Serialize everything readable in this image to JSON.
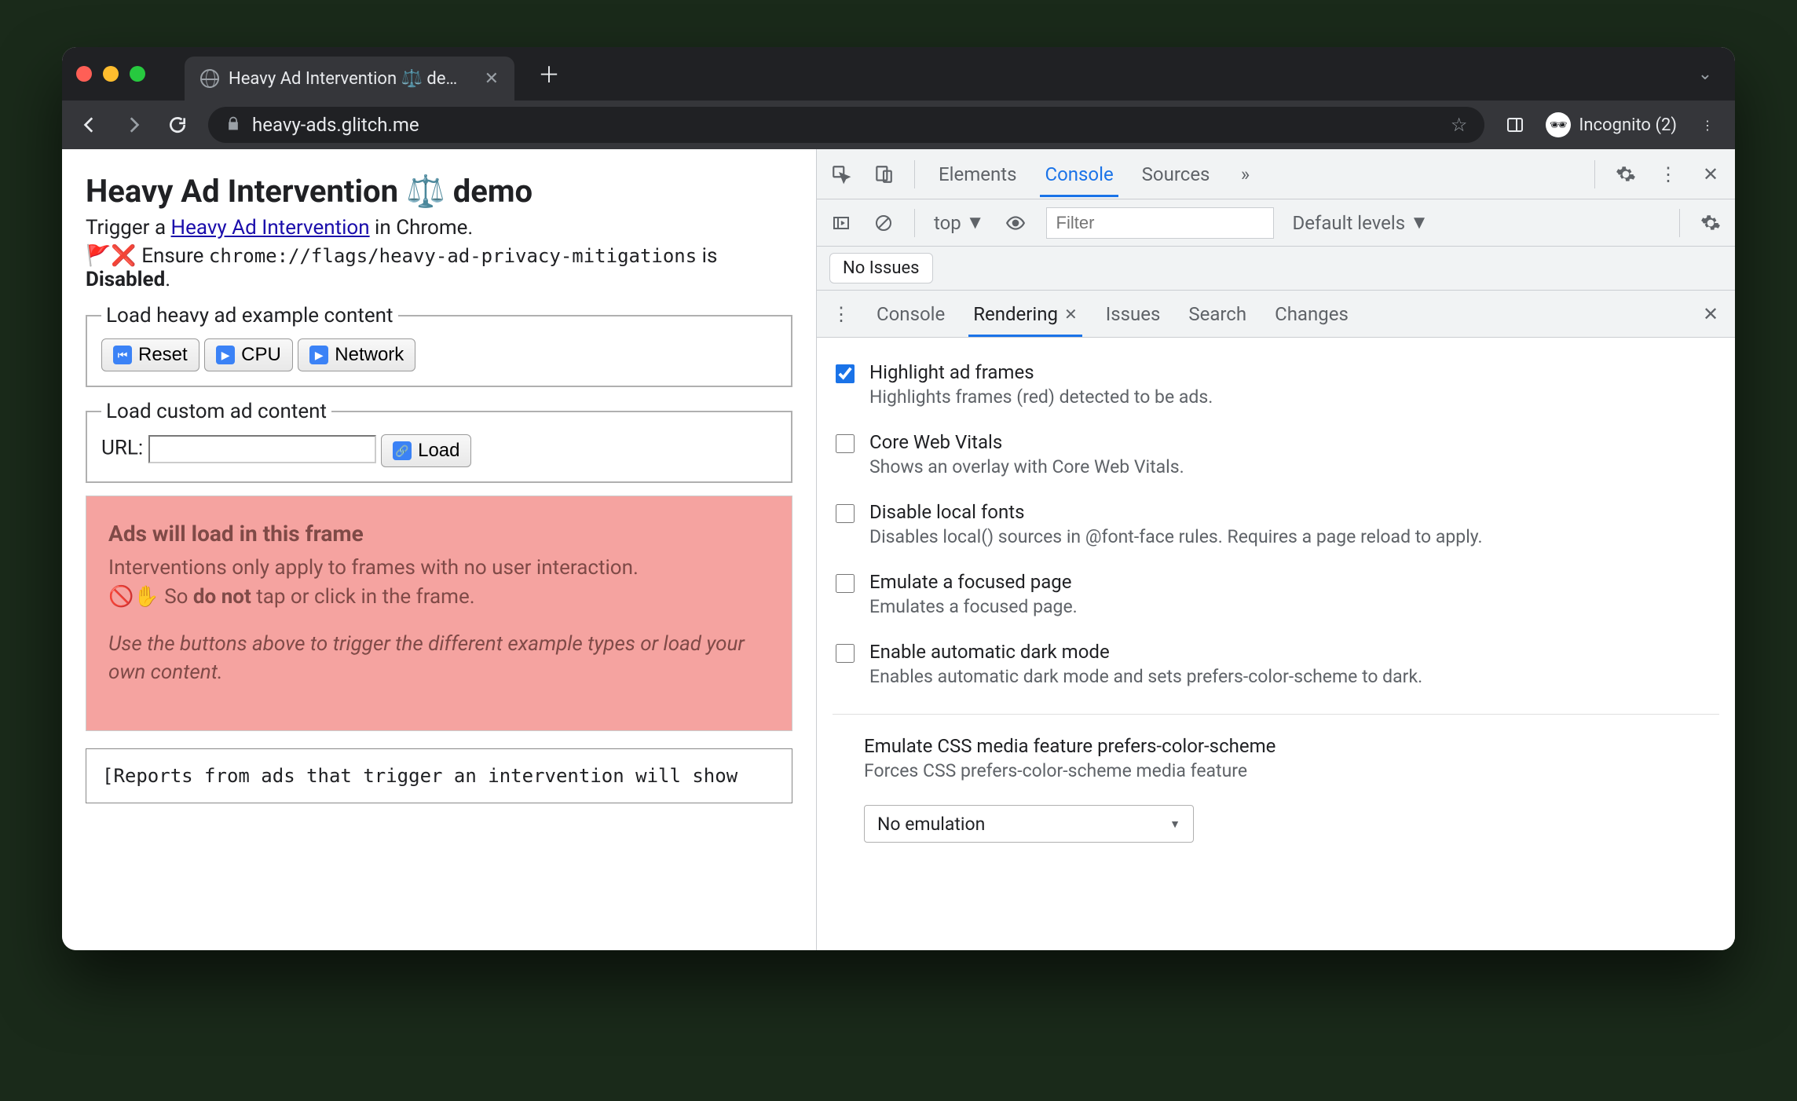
{
  "browser": {
    "tab_title": "Heavy Ad Intervention ⚖️ demo",
    "url": "heavy-ads.glitch.me",
    "incognito_label": "Incognito (2)"
  },
  "page": {
    "heading": "Heavy Ad Intervention ⚖️ demo",
    "subtitle_pre": "Trigger a ",
    "subtitle_link": "Heavy Ad Intervention",
    "subtitle_post": " in Chrome.",
    "warn_pre": "🚩❌ Ensure ",
    "warn_code": "chrome://flags/heavy-ad-privacy-mitigations",
    "warn_post_pre": "is ",
    "warn_post_bold": "Disabled",
    "warn_post_end": ".",
    "fs1_legend": "Load heavy ad example content",
    "btn_reset": "Reset",
    "btn_cpu": "CPU",
    "btn_network": "Network",
    "fs2_legend": "Load custom ad content",
    "url_label": "URL:",
    "btn_load": "Load",
    "ad_header": "Ads will load in this frame",
    "ad_line1": "Interventions only apply to frames with no user interaction.",
    "ad_line2_pre": "🚫✋ So ",
    "ad_line2_bold": "do not",
    "ad_line2_post": " tap or click in the frame.",
    "ad_hint": "Use the buttons above to trigger the different example types or load your own content.",
    "reports": "[Reports from ads that trigger an intervention will show"
  },
  "devtools": {
    "main_tabs": {
      "elements": "Elements",
      "console": "Console",
      "sources": "Sources"
    },
    "console_bar": {
      "context": "top",
      "filter_placeholder": "Filter",
      "levels": "Default levels"
    },
    "no_issues": "No Issues",
    "drawer_tabs": {
      "console": "Console",
      "rendering": "Rendering",
      "issues": "Issues",
      "search": "Search",
      "changes": "Changes"
    },
    "rendering_opts": [
      {
        "title": "Highlight ad frames",
        "desc": "Highlights frames (red) detected to be ads.",
        "checked": true
      },
      {
        "title": "Core Web Vitals",
        "desc": "Shows an overlay with Core Web Vitals.",
        "checked": false
      },
      {
        "title": "Disable local fonts",
        "desc": "Disables local() sources in @font-face rules. Requires a page reload to apply.",
        "checked": false
      },
      {
        "title": "Emulate a focused page",
        "desc": "Emulates a focused page.",
        "checked": false
      },
      {
        "title": "Enable automatic dark mode",
        "desc": "Enables automatic dark mode and sets prefers-color-scheme to dark.",
        "checked": false
      }
    ],
    "emulate_section": {
      "title": "Emulate CSS media feature prefers-color-scheme",
      "desc": "Forces CSS prefers-color-scheme media feature",
      "select_value": "No emulation"
    }
  }
}
